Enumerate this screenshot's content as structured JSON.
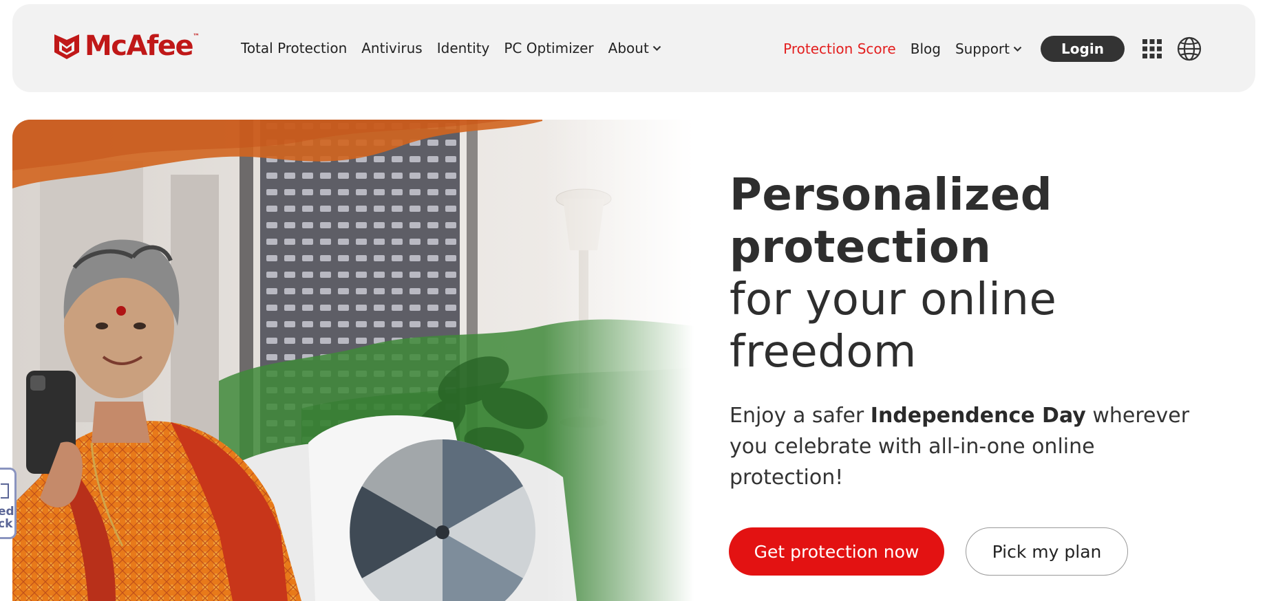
{
  "brand": {
    "name": "McAfee",
    "trademark": "™",
    "color": "#c01818"
  },
  "nav": {
    "left": [
      {
        "label": "Total Protection"
      },
      {
        "label": "Antivirus"
      },
      {
        "label": "Identity"
      },
      {
        "label": "PC Optimizer"
      },
      {
        "label": "About",
        "has_dropdown": true
      }
    ],
    "right": {
      "protection_score": "Protection Score",
      "blog": "Blog",
      "support": "Support",
      "login": "Login",
      "apps_icon": "grid-icon",
      "language_icon": "globe-icon"
    }
  },
  "hero": {
    "headline_bold_1": "Personalized",
    "headline_bold_2": "protection",
    "headline_light_1": "for your online",
    "headline_light_2": "freedom",
    "sub_prefix": "Enjoy a safer ",
    "sub_bold": "Independence Day",
    "sub_suffix": " wherever you celebrate with all-in-one online protection!",
    "primary_cta": "Get protection now",
    "secondary_cta": "Pick my plan"
  },
  "side_widget": {
    "text": "ed\nck"
  },
  "colors": {
    "accent": "#e31212",
    "dark": "#333333",
    "header_bg": "#f2f2f2",
    "saffron": "#d2651f",
    "green": "#2e7d2a"
  }
}
